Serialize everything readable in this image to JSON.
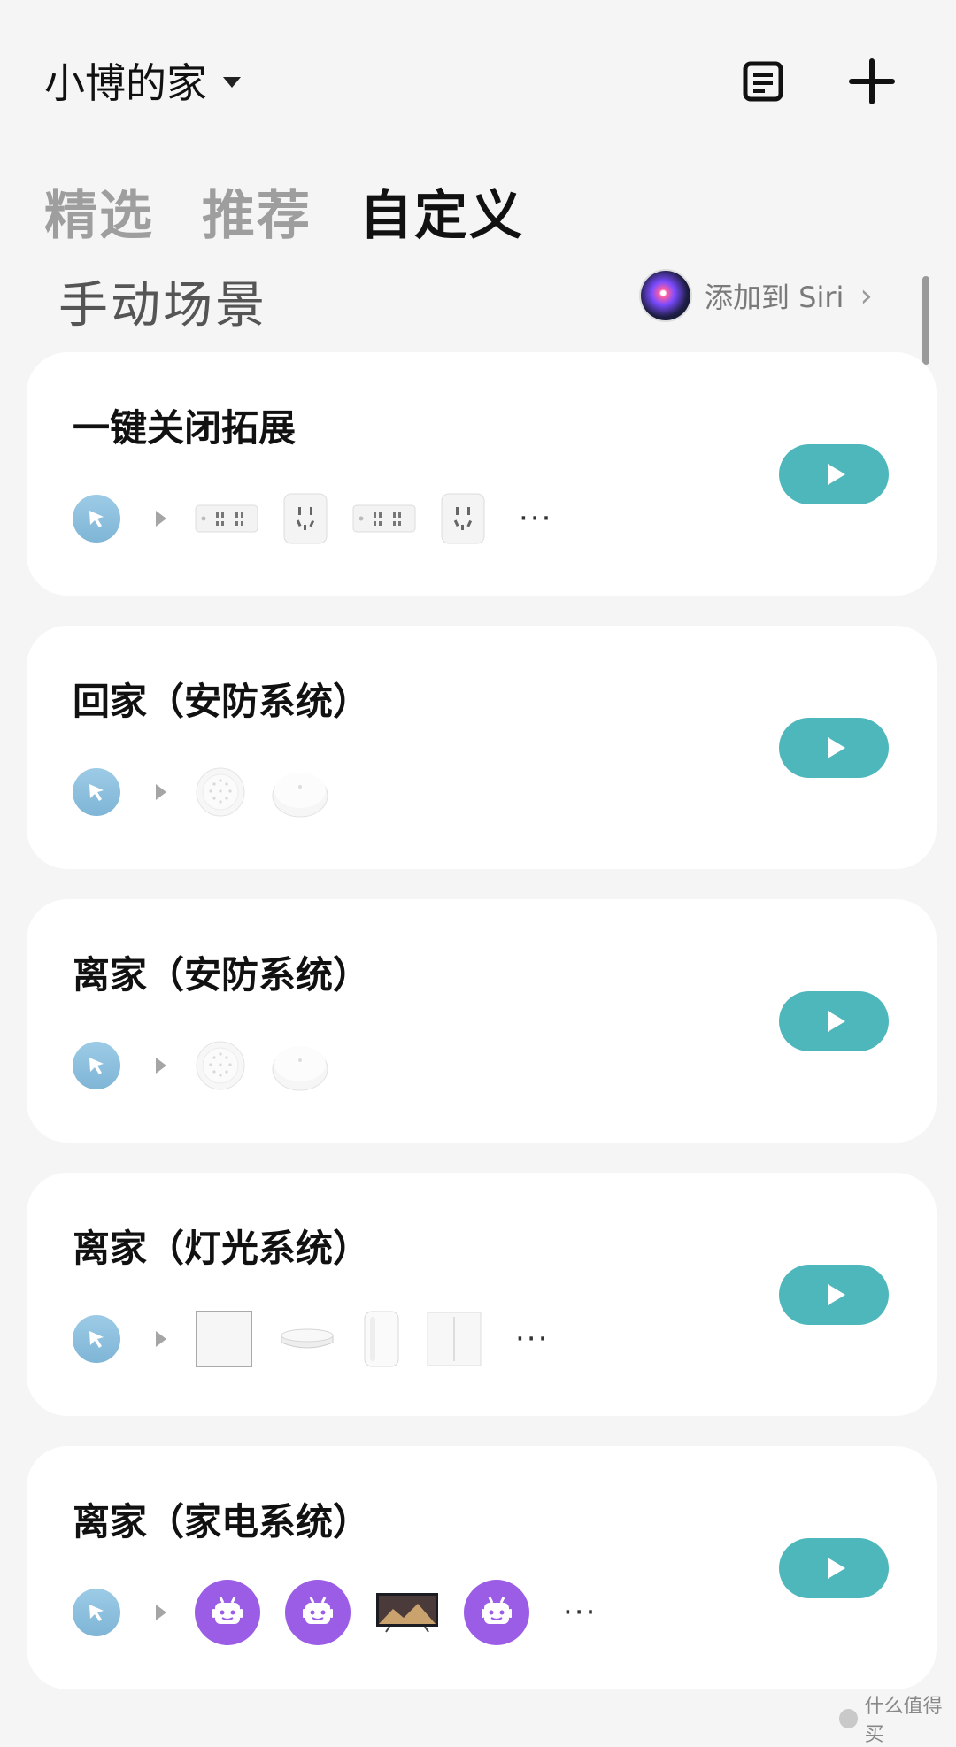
{
  "header": {
    "home_title": "小博的家",
    "icons": [
      "log-icon",
      "add-icon"
    ]
  },
  "tabs": [
    {
      "label": "精选",
      "active": false
    },
    {
      "label": "推荐",
      "active": false
    },
    {
      "label": "自定义",
      "active": true
    }
  ],
  "section": {
    "title": "手动场景",
    "siri_label": "添加到 Siri"
  },
  "scenes": [
    {
      "title": "一键关闭拓展",
      "devices": [
        "power-strip-icon",
        "wall-socket-icon",
        "power-strip-icon",
        "wall-socket-icon"
      ],
      "has_more": true
    },
    {
      "title": "回家（安防系统）",
      "devices": [
        "gateway-icon",
        "button-sensor-icon"
      ],
      "has_more": false
    },
    {
      "title": "离家（安防系统）",
      "devices": [
        "gateway-icon",
        "button-sensor-icon"
      ],
      "has_more": false
    },
    {
      "title": "离家（灯光系统）",
      "devices": [
        "wall-switch-icon",
        "ceiling-light-icon",
        "lamp-icon",
        "double-switch-icon"
      ],
      "has_more": true
    },
    {
      "title": "离家（家电系统）",
      "devices": [
        "robot-icon",
        "robot-icon",
        "tv-icon",
        "robot-icon"
      ],
      "has_more": true
    }
  ],
  "more_symbol": "···",
  "watermark": "什么值得买",
  "colors": {
    "accent": "#4db7bc",
    "trigger": "#8cc0df",
    "robot": "#9b5de5",
    "background": "#f5f5f5"
  }
}
